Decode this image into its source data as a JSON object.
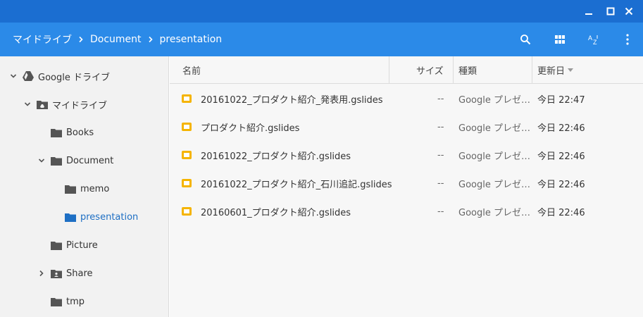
{
  "toolbar": {
    "breadcrumb": [
      "マイドライブ",
      "Document",
      "presentation"
    ]
  },
  "sidebar": {
    "items": [
      {
        "label": "Google ドライブ",
        "icon": "drive-icon",
        "expander": "chevron-down-icon"
      },
      {
        "label": "マイドライブ",
        "icon": "my-drive-icon",
        "expander": "chevron-down-icon"
      },
      {
        "label": "Books",
        "icon": "folder-icon",
        "expander": ""
      },
      {
        "label": "Document",
        "icon": "folder-icon",
        "expander": "chevron-down-icon"
      },
      {
        "label": "memo",
        "icon": "folder-icon",
        "expander": ""
      },
      {
        "label": "presentation",
        "icon": "folder-icon",
        "expander": "",
        "selected": true
      },
      {
        "label": "Picture",
        "icon": "folder-icon",
        "expander": ""
      },
      {
        "label": "Share",
        "icon": "shared-folder-icon",
        "expander": "chevron-right-icon"
      },
      {
        "label": "tmp",
        "icon": "folder-icon",
        "expander": ""
      }
    ]
  },
  "table": {
    "columns": [
      "名前",
      "サイズ",
      "種類",
      "更新日"
    ],
    "rows": [
      {
        "name": "20161022_プロダクト紹介_発表用.gslides",
        "size": "--",
        "type": "Google プレゼ…",
        "modified": "今日 22:47"
      },
      {
        "name": "プロダクト紹介.gslides",
        "size": "--",
        "type": "Google プレゼ…",
        "modified": "今日 22:46"
      },
      {
        "name": "20161022_プロダクト紹介.gslides",
        "size": "--",
        "type": "Google プレゼ…",
        "modified": "今日 22:46"
      },
      {
        "name": "20161022_プロダクト紹介_石川追記.gslides",
        "size": "--",
        "type": "Google プレゼ…",
        "modified": "今日 22:46"
      },
      {
        "name": "20160601_プロダクト紹介.gslides",
        "size": "--",
        "type": "Google プレゼ…",
        "modified": "今日 22:46"
      }
    ]
  },
  "colors": {
    "titlebar": "#1b6ed1",
    "toolbar": "#2b8ae8",
    "selected_text": "#1e6fc4",
    "slides_icon": "#f5b400"
  }
}
